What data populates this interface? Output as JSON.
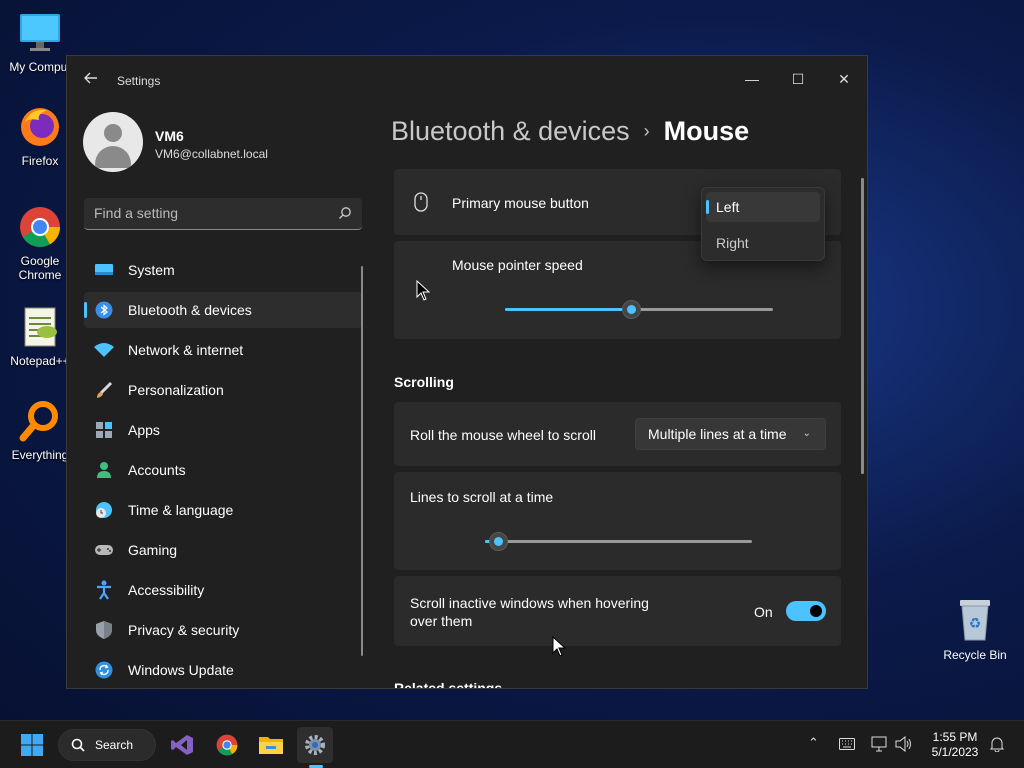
{
  "desktop": {
    "icons": [
      {
        "label": "My Comput",
        "icon": "monitor-icon"
      },
      {
        "label": "Firefox",
        "icon": "firefox-icon"
      },
      {
        "label": "Google Chrome",
        "icon": "chrome-icon"
      },
      {
        "label": "Notepad++",
        "icon": "notepadpp-icon"
      },
      {
        "label": "Everything",
        "icon": "everything-search-icon"
      }
    ],
    "recycle_bin": "Recycle Bin"
  },
  "window": {
    "title": "Settings",
    "minimize": "—",
    "maximize": "☐",
    "close": "✕"
  },
  "profile": {
    "name": "VM6",
    "email": "VM6@collabnet.local"
  },
  "search": {
    "placeholder": "Find a setting"
  },
  "nav": [
    {
      "label": "System",
      "icon": "system-icon",
      "color": "#4cc2ff"
    },
    {
      "label": "Bluetooth & devices",
      "icon": "bluetooth-icon",
      "color": "#3a8ee6",
      "active": true
    },
    {
      "label": "Network & internet",
      "icon": "wifi-icon",
      "color": "#4cc2ff"
    },
    {
      "label": "Personalization",
      "icon": "brush-icon",
      "color": "#e8a060"
    },
    {
      "label": "Apps",
      "icon": "apps-icon",
      "color": "#a0a8b8"
    },
    {
      "label": "Accounts",
      "icon": "accounts-icon",
      "color": "#3fbf7f"
    },
    {
      "label": "Time & language",
      "icon": "globe-clock-icon",
      "color": "#4cc2ff"
    },
    {
      "label": "Gaming",
      "icon": "gamepad-icon",
      "color": "#b8b8b8"
    },
    {
      "label": "Accessibility",
      "icon": "accessibility-icon",
      "color": "#4ca8ff"
    },
    {
      "label": "Privacy & security",
      "icon": "shield-icon",
      "color": "#9aa0a8"
    },
    {
      "label": "Windows Update",
      "icon": "update-icon",
      "color": "#2f8fe0"
    }
  ],
  "breadcrumb": {
    "parent": "Bluetooth & devices",
    "separator": "›",
    "current": "Mouse"
  },
  "settings": {
    "primary_button": {
      "label": "Primary mouse button",
      "options": [
        "Left",
        "Right"
      ],
      "selected": "Left"
    },
    "pointer_speed": {
      "label": "Mouse pointer speed",
      "value_fraction": 0.47
    },
    "scrolling_title": "Scrolling",
    "roll_wheel": {
      "label": "Roll the mouse wheel to scroll",
      "value": "Multiple lines at a time"
    },
    "lines_to_scroll": {
      "label": "Lines to scroll at a time",
      "value_fraction": 0.05
    },
    "scroll_inactive": {
      "label_line1": "Scroll inactive windows when hovering",
      "label_line2": "over them",
      "state": "On"
    },
    "related_title": "Related settings"
  },
  "taskbar": {
    "search_label": "Search",
    "time": "1:55 PM",
    "date": "5/1/2023"
  },
  "colors": {
    "accent": "#4cc2ff",
    "window_bg": "#202020",
    "card_bg": "#2b2b2b"
  }
}
